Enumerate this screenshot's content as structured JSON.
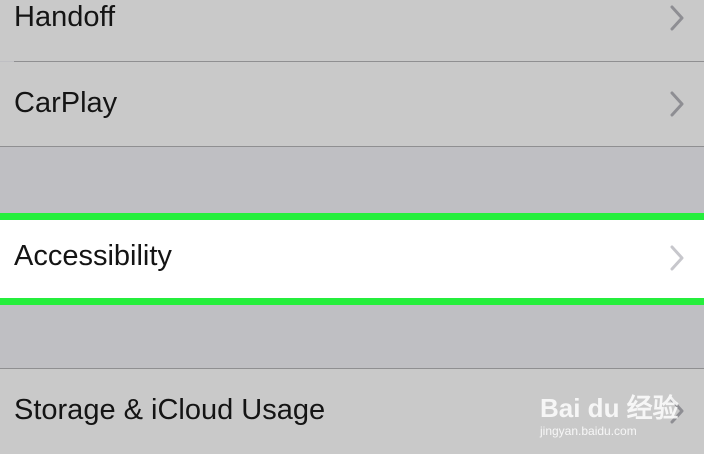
{
  "settings": {
    "items": [
      {
        "label": "Handoff"
      },
      {
        "label": "CarPlay"
      },
      {
        "label": "Accessibility"
      },
      {
        "label": "Storage & iCloud Usage"
      }
    ]
  },
  "highlight_color": "#25ee3c",
  "icons": {
    "chevron": "chevron-right-icon"
  },
  "watermark": {
    "brand": "Bai du 经验",
    "url": "jingyan.baidu.com"
  }
}
